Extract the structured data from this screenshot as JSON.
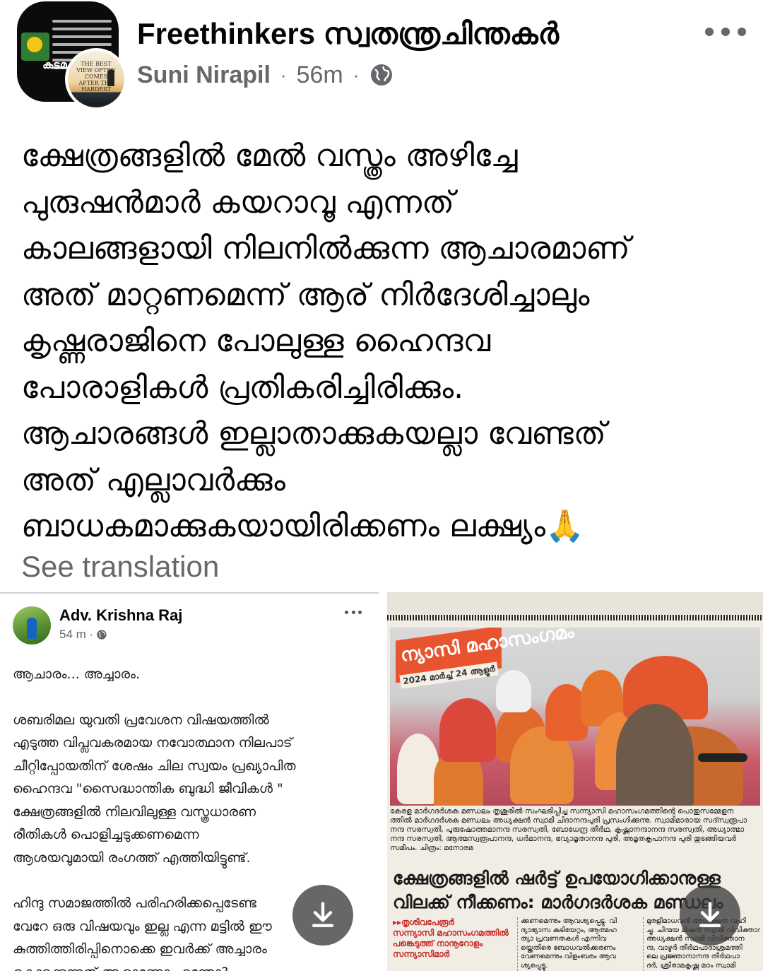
{
  "header": {
    "group_name": "Freethinkers സ്വതന്ത്രചിന്തകർ",
    "author": "Suni Nirapil",
    "separator": "·",
    "time": "56m",
    "separator2": "·",
    "privacy_icon": "globe-icon",
    "more_icon": "more-horizontal-icon",
    "group_avatar_word": "കടമ",
    "user_avatar_text": "THE BEST VIEW OFTEN COMES AFTER THE HARDEST CLIMB"
  },
  "post": {
    "lines": [
      "ക്ഷേത്രങ്ങളിൽ മേൽ വസ്ത്രം അഴിച്ചേ",
      "പുരുഷൻമാർ കയറാവൂ എന്നത്",
      "കാലങ്ങളായി നിലനിൽക്കുന്ന ആചാരമാണ്",
      "അത് മാറ്റണമെന്ന് ആര് നിർദേശിച്ചാലും",
      "കൃഷ്ണരാജിനെ പോലുള്ള ഹൈന്ദവ",
      "പോരാളികൾ പ്രതികരിച്ചിരിക്കും.",
      "ആചാരങ്ങൾ ഇല്ലാതാക്കുകയല്ലാ വേണ്ടത്",
      "അത് എല്ലാവർക്കും",
      "ബാധകമാക്കുകയായിരിക്കണം ലക്ഷ്യം🙏"
    ],
    "see_translation": "See translation"
  },
  "attached_left": {
    "name": "Adv. Krishna Raj",
    "time": "54 m ·",
    "privacy_icon": "globe-icon",
    "more_icon": "more-horizontal-icon",
    "paragraphs": [
      [
        "ആചാരം... അച്ചാരം."
      ],
      [
        "ശബരിമല യുവതി പ്രവേശന വിഷയത്തിൽ",
        "എടുത്ത വിപ്ലവകരമായ നവോത്ഥാന നിലപാട്",
        "ചീറ്റിപ്പോയതിന് ശേഷം ചില സ്വയം പ്രഖ്യാപിത",
        "ഹൈന്ദവ \"സൈദ്ധാന്തിക ബുദ്ധി ജീവികൾ \"",
        "ക്ഷേത്രങ്ങളിൽ നിലവിലുള്ള വസ്ത്രധാരണ",
        "രീതികൾ പൊളിച്ചടുക്കണമെന്ന",
        "ആശയവുമായി രംഗത്ത് എത്തിയിട്ടുണ്ട്."
      ],
      [
        "ഹിന്ദു സമാജത്തിൽ പരിഹരിക്കപ്പെടേണ്ട",
        "വേറേ ഒരു വിഷയവും ഇല്ല എന്ന മട്ടിൽ ഈ",
        "കുത്തിത്തിരിപ്പിനൊക്കെ ഇവർക്ക് അച്ചാരം",
        "കൊടുക്കുന്നത് ആരാണോ എന്തോ?"
      ]
    ]
  },
  "attached_right": {
    "banner": "ന്യാസി മഹാസംഗമം",
    "banner_date": "2024 മാർച്ച് 24 ആളൂർ",
    "caption_lines": [
      "കേരള മാർഗദർശക മണ്ഡലം തൃശൂരിൽ സംഘടിപ്പിച്ച സന്ന്യാസി മഹാസംഗമത്തിന്റെ പൊതുസമ്മേളന",
      "ത്തിൽ മാർഗദർശക മണ്ഡലം അധ്യക്ഷൻ സ്വാമി ചിദാനന്ദപുരി പ്രസംഗിക്കുന്നു. സ്വാമിമാരായ സദ്സ്വരൂപാ",
      "നന്ദ സരസ്വതി, പുരുഷോത്തമാനന്ദ സരസ്വതി, ബോധേന്ദ്ര തീർഥ, കൃഷ്ണാനന്ദാനന്ദ സരസ്വതി, അധ്യാത്മാ",
      "നന്ദ സരസ്വതി, ആത്മസ്വരൂപാനന്ദ, ധർമാനന്ദ, ഭവ്യാമൃതാനന്ദ പുരി, അമൃതകൃപാനന്ദ പുരി തുടങ്ങിയവർ",
      "സമീപം. ചിത്രം: മനോരമ"
    ],
    "headline_lines": [
      "ക്ഷേത്രങ്ങളിൽ ഷർട്ട് ഉപയോഗിക്കാനുള്ള",
      "വിലക്ക് നീക്കണം: മാർഗദർശക മണ്ഡലം"
    ],
    "columns": [
      [
        "▸▸തൃശിവപേരൂർ",
        "സന്ന്യാസി മഹാസംഗമത്തിൽ",
        "പങ്കെടുത്ത് നാനൂറോളം",
        "സന്ന്യാസിമാർ"
      ],
      [
        "ക്കണമെന്നും ആവശ്യപ്പെട്ടു. വി",
        "ദ്യാഭ്യാസ കുടിയേറ്റം, ആത്മഹ",
        "ത്യാ പ്രവണതകൾ എന്നിവ",
        "യ്ക്കെതിരെ ബോധവൽക്കരണം",
        "വേണമെന്നും വിളംബരം ആവ",
        "ശ്യപ്പെട്ടു."
      ],
      [
        "മുരളീമാധവൻ അധ്യക്ഷത വഹി",
        "ച്ചു. ചിന്മയ മിഷൻ സ്വാമി വിവിക്താന",
        "അധ്യക്ഷൻ സ്വാമി വിവിക്താന",
        "ന്ദ, വാഴൂർ തീർഥപാദാശ്രമത്തി",
        "ലെ പ്രജ്ഞാനാനന്ദ തീർഥപാ",
        "ദർ, ശ്രീരാമകൃഷ്ണ മഠം സ്വാമി"
      ]
    ]
  },
  "download_icon": "download-icon"
}
